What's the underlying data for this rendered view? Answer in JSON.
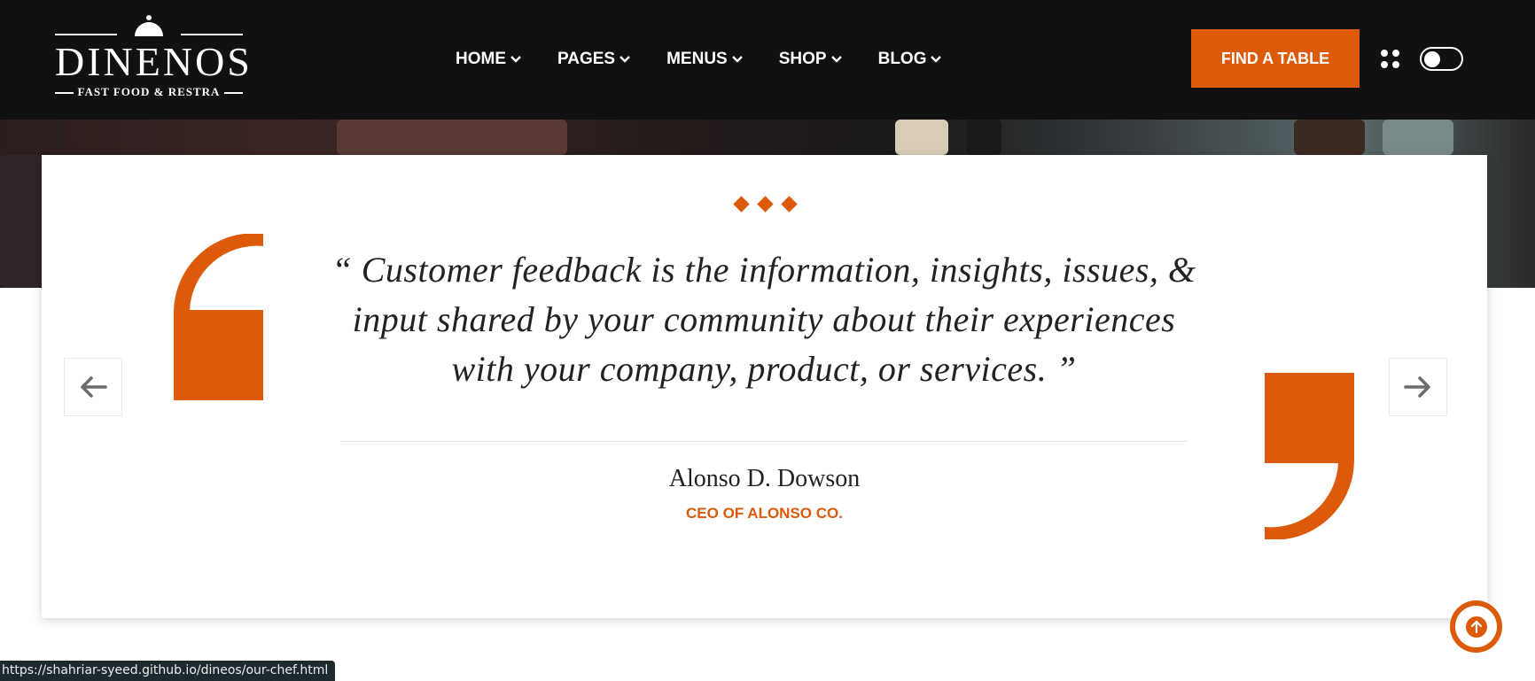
{
  "header": {
    "logo": {
      "brand": "DINENOS",
      "tagline": "FAST FOOD & RESTRA"
    },
    "nav": [
      {
        "label": "HOME"
      },
      {
        "label": "PAGES"
      },
      {
        "label": "MENUS"
      },
      {
        "label": "SHOP"
      },
      {
        "label": "BLOG"
      }
    ],
    "cta_label": "FIND A TABLE",
    "icons": {
      "menu": "four-dots-icon",
      "theme": "toggle-switch"
    }
  },
  "testimonial": {
    "quote": "“ Customer feedback is the information, insights, issues, & input shared by your community about their experiences with your company, product, or services. ”",
    "author": "Alonso D. Dowson",
    "role": "CEO OF ALONSO CO.",
    "icons": {
      "prev": "arrow-left-icon",
      "next": "arrow-right-icon",
      "ornament": "diamond-icon"
    }
  },
  "status_bar": {
    "url": "https://shahriar-syeed.github.io/dineos/our-chef.html"
  },
  "colors": {
    "accent": "#dc5a0a",
    "header_bg": "#111111",
    "text": "#222222"
  }
}
